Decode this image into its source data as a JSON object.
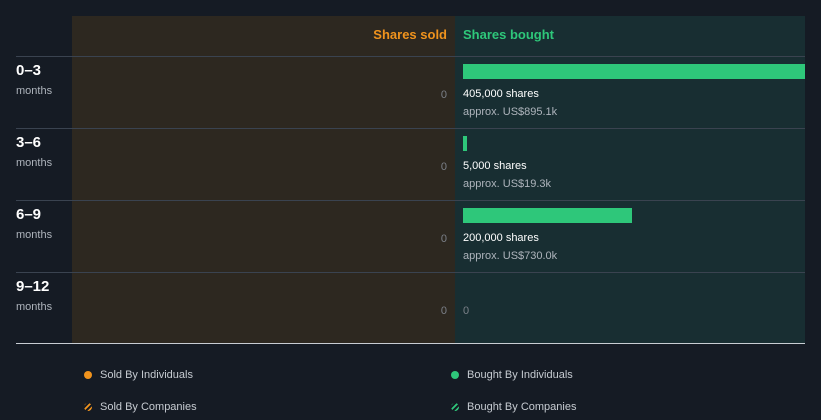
{
  "chart_data": {
    "type": "bar",
    "headers": {
      "sold": "Shares sold",
      "bought": "Shares bought"
    },
    "rows": [
      {
        "range": "0–3",
        "unit": "months",
        "sold_label": "0",
        "bought": 405000,
        "bought_label": "405,000 shares",
        "value_label": "approx. US$895.1k"
      },
      {
        "range": "3–6",
        "unit": "months",
        "sold_label": "0",
        "bought": 5000,
        "bought_label": "5,000 shares",
        "value_label": "approx. US$19.3k"
      },
      {
        "range": "6–9",
        "unit": "months",
        "sold_label": "0",
        "bought": 200000,
        "bought_label": "200,000 shares",
        "value_label": "approx. US$730.0k"
      },
      {
        "range": "9–12",
        "unit": "months",
        "sold_label": "0",
        "bought": 0,
        "bought_label": "0",
        "value_label": ""
      }
    ],
    "bought_max": 405000,
    "legend": [
      {
        "label": "Sold By Individuals",
        "color": "#f0931d",
        "style": "dot"
      },
      {
        "label": "Bought By Individuals",
        "color": "#2ec77a",
        "style": "dot"
      },
      {
        "label": "Sold By Companies",
        "color": "#f0931d",
        "style": "hatch"
      },
      {
        "label": "Bought By Companies",
        "color": "#2ec77a",
        "style": "hatch"
      }
    ],
    "colors": {
      "sold": "#f0931d",
      "bought": "#2ec77a"
    }
  }
}
